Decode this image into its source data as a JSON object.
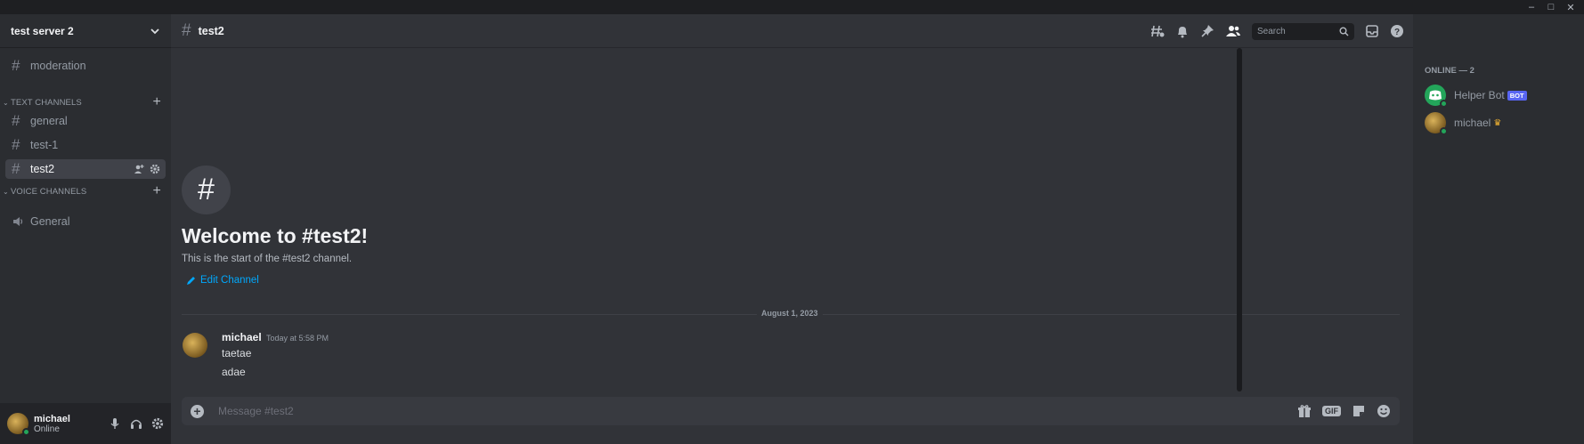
{
  "window": {
    "minimize": "–",
    "maximize": "□",
    "close": "✕"
  },
  "server": {
    "name": "test server 2"
  },
  "sidebar": {
    "channels_top": [
      {
        "name": "moderation"
      }
    ],
    "text_category": "TEXT CHANNELS",
    "text_channels": [
      {
        "name": "general"
      },
      {
        "name": "test-1"
      },
      {
        "name": "test2"
      }
    ],
    "voice_category": "VOICE CHANNELS",
    "voice_channels": [
      {
        "name": "General"
      }
    ]
  },
  "user": {
    "name": "michael",
    "status": "Online"
  },
  "chat": {
    "channel": "test2",
    "search_placeholder": "Search",
    "welcome_title": "Welcome to #test2!",
    "welcome_sub": "This is the start of the #test2 channel.",
    "edit_channel": "Edit Channel",
    "date_divider": "August 1, 2023",
    "message": {
      "author": "michael",
      "time": "Today at 5:58 PM",
      "lines": [
        "taetae",
        "adae"
      ]
    },
    "composer_placeholder": "Message #test2",
    "gif_label": "GIF"
  },
  "members": {
    "header": "ONLINE — 2",
    "list": [
      {
        "name": "Helper Bot",
        "tag": "BOT"
      },
      {
        "name": "michael"
      }
    ]
  },
  "colors": {
    "accent": "#5865f2",
    "online": "#23a55a",
    "link": "#00a8fc",
    "crown": "#f0b232"
  }
}
